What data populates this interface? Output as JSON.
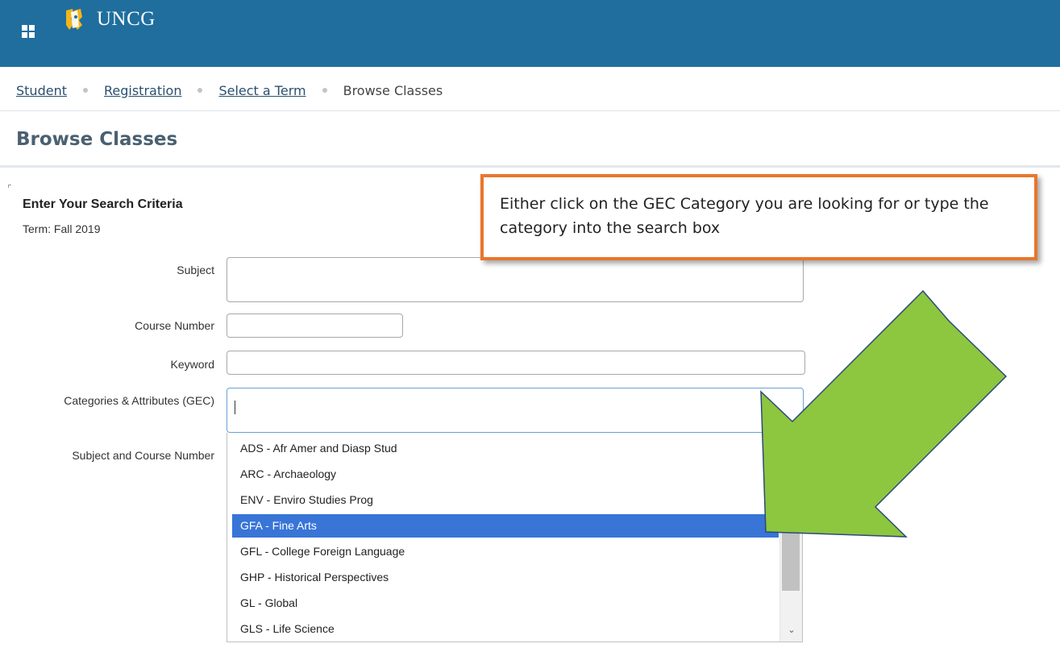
{
  "header": {
    "logo_text": "UNCG",
    "colors": {
      "bar": "#1f6e9e"
    }
  },
  "breadcrumb": {
    "items": [
      "Student",
      "Registration",
      "Select a Term"
    ],
    "current": "Browse Classes"
  },
  "page": {
    "title": "Browse Classes"
  },
  "form": {
    "heading": "Enter Your Search Criteria",
    "term": "Term: Fall 2019",
    "subject_label": "Subject",
    "course_number_label": "Course Number",
    "keyword_label": "Keyword",
    "categories_label": "Categories & Attributes (GEC)",
    "subject_course_label": "Subject and Course Number"
  },
  "dropdown": {
    "options": [
      "ADS - Afr Amer and Diasp Stud",
      "ARC - Archaeology",
      "ENV - Enviro Studies Prog",
      "GFA - Fine Arts",
      "GFL - College Foreign Language",
      "GHP - Historical Perspectives",
      "GL - Global",
      "GLS - Life Science"
    ],
    "selected": "GFA - Fine Arts"
  },
  "callout": {
    "text": "Either click on the GEC Category you are looking for or type the category into the search box",
    "colors": {
      "border": "#e8762c",
      "arrow": "#8dc63f"
    }
  }
}
